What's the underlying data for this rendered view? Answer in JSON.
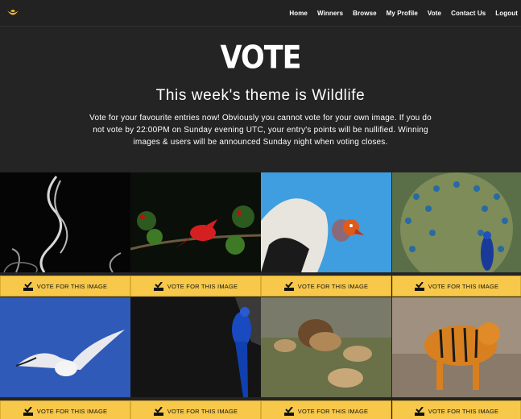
{
  "nav": {
    "links": [
      "Home",
      "Winners",
      "Browse",
      "My Profile",
      "Vote",
      "Contact Us",
      "Logout"
    ]
  },
  "hero": {
    "title": "VOTE",
    "theme": "This week's theme is Wildlife",
    "description": "Vote for your favourite entries now! Obviously you cannot vote for your own image. If you do not vote by 22:00PM on Sunday evening UTC, your entry's points will be nullified. Winning images & users will be announced Sunday night when voting closes."
  },
  "vote_button_label": "VOTE FOR THIS IMAGE",
  "colors": {
    "accent": "#f7c84a",
    "background": "#242424",
    "navbar": "#222222"
  }
}
